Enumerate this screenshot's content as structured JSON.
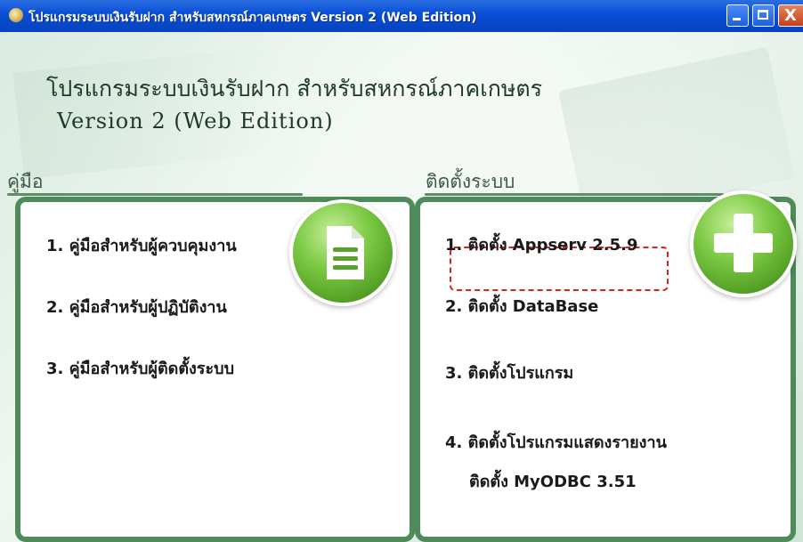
{
  "window": {
    "title": "โปรแกรมระบบเงินรับฝาก สำหรับสหกรณ์ภาคเกษตร Version 2 (Web Edition)",
    "close_glyph": "X"
  },
  "header": {
    "title": "โปรแกรมระบบเงินรับฝาก สำหรับสหกรณ์ภาคเกษตร",
    "subtitle": "Version 2 (Web Edition)"
  },
  "manual": {
    "heading": "คู่มือ",
    "icon": "document-icon",
    "items": [
      {
        "label": "1. คู่มือสำหรับผู้ควบคุมงาน"
      },
      {
        "label": "2. คู่มือสำหรับผู้ปฏิบัติงาน"
      },
      {
        "label": "3. คู่มือสำหรับผู้ติดตั้งระบบ"
      }
    ]
  },
  "install": {
    "heading": "ติดตั้งระบบ",
    "icon": "plus-icon",
    "items": [
      {
        "label": "1. ติดตั้ง Appserv 2.5.9",
        "highlighted": true
      },
      {
        "label": "2. ติดตั้ง DataBase"
      },
      {
        "label": "3. ติดตั้งโปรแกรม"
      },
      {
        "label": "4. ติดตั้งโปรแกรมแสดงรายงาน"
      },
      {
        "label": "ติดตั้ง MyODBC 3.51"
      }
    ]
  },
  "colors": {
    "panel_border": "#4f8a5a",
    "highlight": "#e02020",
    "titlebar": "#0a4fd6"
  }
}
